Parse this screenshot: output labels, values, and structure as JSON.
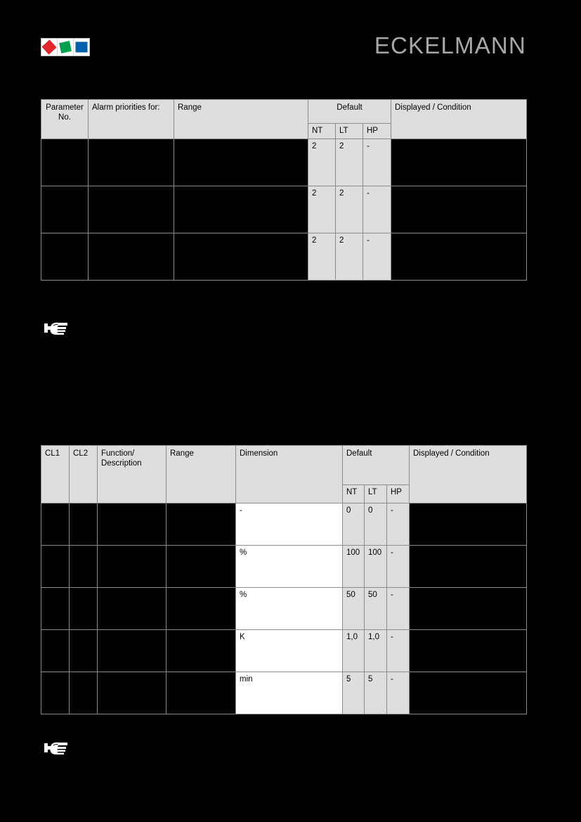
{
  "document": {
    "brand": "ECKELMANN",
    "logo": {
      "name": "eckelmann-logo",
      "squares": [
        {
          "name": "red-diamond",
          "color": "#e1262c"
        },
        {
          "name": "green-square",
          "color": "#00a14b"
        },
        {
          "name": "blue-square",
          "color": "#0060ac"
        }
      ]
    },
    "page_background": "#000000",
    "table_header_fill": "#dedede",
    "table_cell_fill": "#ffffff",
    "table_border": "#8c8c8c"
  },
  "table_alarm_priorities": {
    "name": "alarm-priorities-table",
    "headers": {
      "parameter_no": "Parameter No.",
      "alarm_priorities_for": "Alarm priorities for:",
      "range": "Range",
      "default": "Default",
      "displayed_condition": "Displayed / Condition"
    },
    "sub_headers": {
      "nt": "NT",
      "lt": "LT",
      "hp": "HP"
    },
    "rows": [
      {
        "parameter_no": "",
        "alarm_priorities_for": "",
        "range": "",
        "nt": "2",
        "lt": "2",
        "hp": "-",
        "displayed_condition": ""
      },
      {
        "parameter_no": "",
        "alarm_priorities_for": "",
        "range": "",
        "nt": "2",
        "lt": "2",
        "hp": "-",
        "displayed_condition": ""
      },
      {
        "parameter_no": "",
        "alarm_priorities_for": "",
        "range": "",
        "nt": "2",
        "lt": "2",
        "hp": "-",
        "displayed_condition": ""
      }
    ]
  },
  "table_parameters": {
    "name": "parameters-table",
    "headers": {
      "cl1": "CL1",
      "cl2": "CL2",
      "function_description": "Function/ Description",
      "function_description_line1": "Function/",
      "function_description_line2": "Description",
      "range": "Range",
      "dimension": "Dimension",
      "default": "Default",
      "displayed_condition": "Displayed / Condition"
    },
    "sub_headers": {
      "nt": "NT",
      "lt": "LT",
      "hp": "HP"
    },
    "rows": [
      {
        "cl1": "",
        "cl2": "",
        "function_description": "",
        "range": "",
        "dimension": "-",
        "nt": "0",
        "lt": "0",
        "hp": "-",
        "displayed_condition": ""
      },
      {
        "cl1": "",
        "cl2": "",
        "function_description": "",
        "range": "",
        "dimension": "%",
        "nt": "100",
        "lt": "100",
        "hp": "-",
        "displayed_condition": ""
      },
      {
        "cl1": "",
        "cl2": "",
        "function_description": "",
        "range": "",
        "dimension": "%",
        "nt": "50",
        "lt": "50",
        "hp": "-",
        "displayed_condition": ""
      },
      {
        "cl1": "",
        "cl2": "",
        "function_description": "",
        "range": "",
        "dimension": "K",
        "nt": "1,0",
        "lt": "1,0",
        "hp": "-",
        "displayed_condition": ""
      },
      {
        "cl1": "",
        "cl2": "",
        "function_description": "",
        "range": "",
        "dimension": "min",
        "nt": "5",
        "lt": "5",
        "hp": "-",
        "displayed_condition": ""
      }
    ]
  },
  "notes": [
    {
      "name": "note-marker-top",
      "icon": "pointing-hand-icon",
      "text": ""
    },
    {
      "name": "note-marker-bottom",
      "icon": "pointing-hand-icon",
      "text": ""
    }
  ]
}
